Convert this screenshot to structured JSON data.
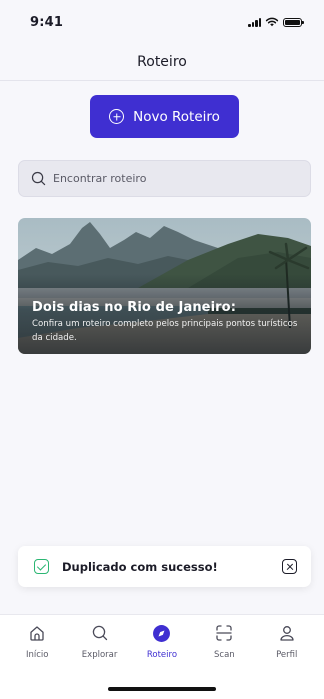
{
  "status_bar": {
    "time": "9:41"
  },
  "header": {
    "title": "Roteiro"
  },
  "new_route_button": {
    "label": "Novo Roteiro"
  },
  "search": {
    "placeholder": "Encontrar roteiro"
  },
  "route_card": {
    "title": "Dois dias no Rio de Janeiro:",
    "description": "Confira um roteiro completo pelos principais pontos turísticos da cidade."
  },
  "toast": {
    "message": "Duplicado com sucesso!"
  },
  "tabbar": {
    "tabs": [
      {
        "label": "Início",
        "icon": "home-icon",
        "active": false
      },
      {
        "label": "Explorar",
        "icon": "search-icon",
        "active": false
      },
      {
        "label": "Roteiro",
        "icon": "compass-icon",
        "active": true
      },
      {
        "label": "Scan",
        "icon": "scan-icon",
        "active": false
      },
      {
        "label": "Perfil",
        "icon": "user-icon",
        "active": false
      }
    ]
  },
  "colors": {
    "accent": "#3f2fd1",
    "success": "#2bb673",
    "background": "#f7f7fb"
  }
}
